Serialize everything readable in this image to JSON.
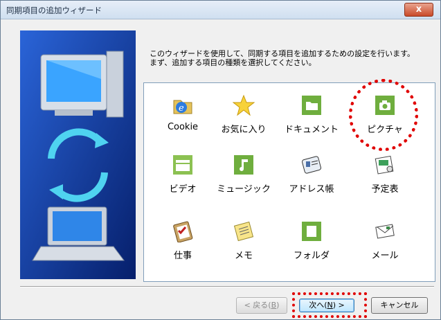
{
  "window": {
    "title": "同期項目の追加ウィザード",
    "close": "x"
  },
  "instructions": {
    "line1": "このウィザードを使用して、同期する項目を追加するための設定を行います。",
    "line2": "まず、追加する項目の種類を選択してください。"
  },
  "items": [
    {
      "label": "Cookie",
      "icon": "cookie-folder-icon"
    },
    {
      "label": "お気に入り",
      "icon": "favorites-star-icon"
    },
    {
      "label": "ドキュメント",
      "icon": "documents-folder-icon"
    },
    {
      "label": "ピクチャ",
      "icon": "pictures-camera-icon"
    },
    {
      "label": "ビデオ",
      "icon": "video-film-icon"
    },
    {
      "label": "ミュージック",
      "icon": "music-note-icon"
    },
    {
      "label": "アドレス帳",
      "icon": "address-book-icon"
    },
    {
      "label": "予定表",
      "icon": "calendar-icon"
    },
    {
      "label": "仕事",
      "icon": "tasks-clipboard-icon"
    },
    {
      "label": "メモ",
      "icon": "notes-memo-icon"
    },
    {
      "label": "フォルダ",
      "icon": "folder-icon"
    },
    {
      "label": "メール",
      "icon": "mail-icon"
    }
  ],
  "buttons": {
    "back": "< 戻る(",
    "back_key": "B",
    "back_end": ")",
    "next": "次へ(",
    "next_key": "N",
    "next_end": ") >",
    "cancel": "キャンセル"
  },
  "colors": {
    "sidebar": "#0e2f8d",
    "highlight": "#e00000"
  }
}
